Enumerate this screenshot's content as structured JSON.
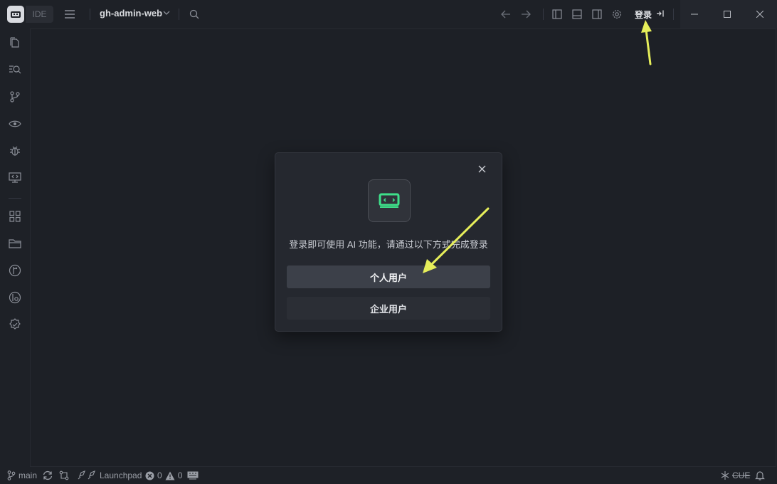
{
  "titlebar": {
    "ide_label": "IDE",
    "project_name": "gh-admin-web",
    "login_label": "登录"
  },
  "dialog": {
    "message": "登录即可使用 AI 功能，请通过以下方式完成登录",
    "personal_label": "个人用户",
    "enterprise_label": "企业用户"
  },
  "statusbar": {
    "branch": "main",
    "launchpad": "Launchpad",
    "errors": "0",
    "warnings": "0",
    "encoding": "CUE"
  },
  "colors": {
    "accent_green": "#3ee08a",
    "annotation_arrow": "#e6ee5a",
    "background": "#1e2127"
  }
}
